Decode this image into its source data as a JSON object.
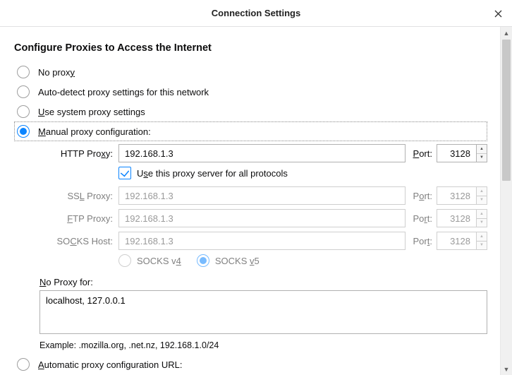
{
  "title": "Connection Settings",
  "section_heading": "Configure Proxies to Access the Internet",
  "options": {
    "no_proxy": "No proxy",
    "auto_detect": "Auto-detect proxy settings for this network",
    "use_system": "Use system proxy settings",
    "manual": "Manual proxy configuration:",
    "auto_config": "Automatic proxy configuration URL:"
  },
  "fields": {
    "http_label": "HTTP Proxy:",
    "ssl_label": "SSL Proxy:",
    "ftp_label": "FTP Proxy:",
    "socks_label": "SOCKS Host:",
    "port_label": "Port:",
    "http_host": "192.168.1.3",
    "http_port": "3128",
    "ssl_host": "192.168.1.3",
    "ssl_port": "3128",
    "ftp_host": "192.168.1.3",
    "ftp_port": "3128",
    "socks_host": "192.168.1.3",
    "socks_port": "3128"
  },
  "use_all_label": "Use this proxy server for all protocols",
  "socks": {
    "v4": "SOCKS v4",
    "v5": "SOCKS v5"
  },
  "no_proxy_for_label": "No Proxy for:",
  "no_proxy_for_value": "localhost, 127.0.0.1",
  "example_text": "Example: .mozilla.org, .net.nz, 192.168.1.0/24"
}
